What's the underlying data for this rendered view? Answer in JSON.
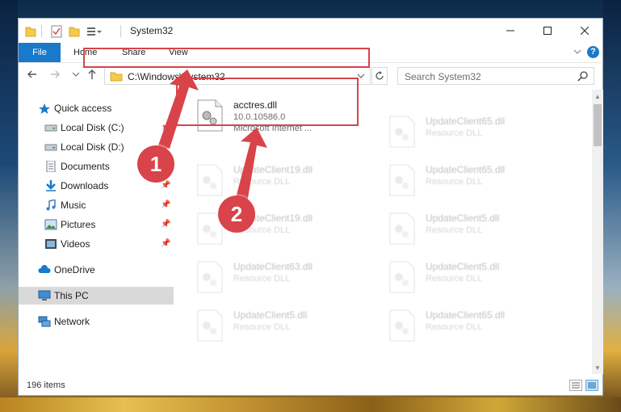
{
  "window": {
    "title": "System32",
    "minimize_glyph": "—",
    "maximize_glyph": "☐",
    "close_glyph": "✕"
  },
  "ribbon": {
    "tabs": [
      "File",
      "Home",
      "Share",
      "View"
    ],
    "help": "?"
  },
  "addressbar": {
    "path": "C:\\Windows\\System32",
    "search_placeholder": "Search System32"
  },
  "sidebar": {
    "items": [
      {
        "label": "Quick access",
        "icon": "star-icon",
        "pinned": false
      },
      {
        "label": "Local Disk (C:)",
        "icon": "drive-icon",
        "pinned": true
      },
      {
        "label": "Local Disk (D:)",
        "icon": "drive-icon",
        "pinned": true
      },
      {
        "label": "Documents",
        "icon": "documents-icon",
        "pinned": true
      },
      {
        "label": "Downloads",
        "icon": "download-icon",
        "pinned": true
      },
      {
        "label": "Music",
        "icon": "music-icon",
        "pinned": true
      },
      {
        "label": "Pictures",
        "icon": "pictures-icon",
        "pinned": true
      },
      {
        "label": "Videos",
        "icon": "videos-icon",
        "pinned": true
      },
      {
        "label": "OneDrive",
        "icon": "cloud-icon",
        "pinned": false
      },
      {
        "label": "This PC",
        "icon": "computer-icon",
        "pinned": false,
        "selected": true
      },
      {
        "label": "Network",
        "icon": "network-icon",
        "pinned": false
      }
    ]
  },
  "files": [
    {
      "name": "acctres.dll",
      "version": "10.0.10586.0",
      "description": "Microsoft Internet ..."
    },
    {
      "name": "UpdateClient65.dll",
      "type": "Resource DLL"
    },
    {
      "name": "UpdateClient19.dll",
      "type": "Resource DLL"
    },
    {
      "name": "UpdateClient65.dll",
      "type": "Resource DLL"
    },
    {
      "name": "UpdateClient19.dll",
      "type": "Resource DLL"
    },
    {
      "name": "UpdateClient5.dll",
      "type": "Resource DLL"
    },
    {
      "name": "UpdateClient63.dll",
      "type": "Resource DLL"
    },
    {
      "name": "UpdateClient5.dll",
      "type": "Resource DLL"
    },
    {
      "name": "UpdateClient5.dll",
      "type": "Resource DLL"
    },
    {
      "name": "UpdateClient65.dll",
      "type": "Resource DLL"
    }
  ],
  "status": {
    "item_count": "196 items"
  },
  "callouts": [
    "1",
    "2"
  ],
  "colors": {
    "accent": "#1979ca",
    "highlight": "#d9434a"
  }
}
